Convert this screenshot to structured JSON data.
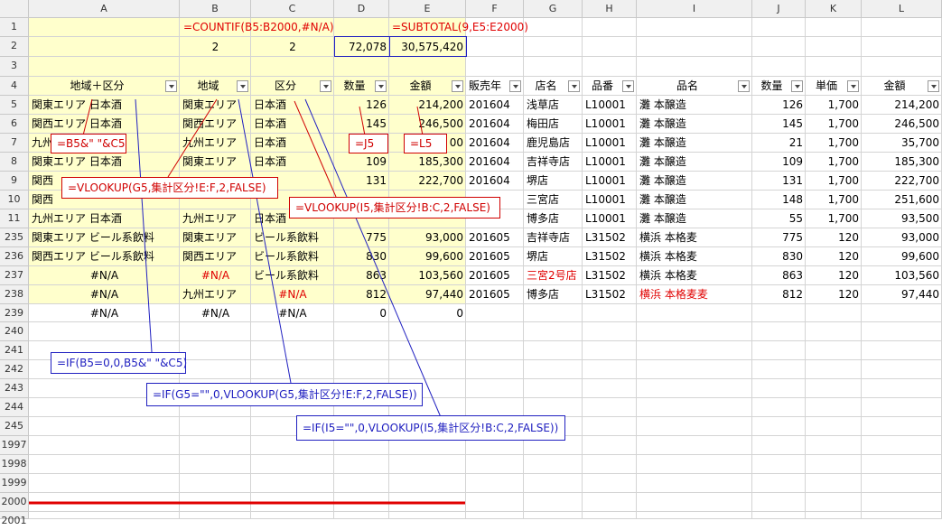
{
  "columns": [
    "A",
    "B",
    "C",
    "D",
    "E",
    "F",
    "G",
    "H",
    "I",
    "J",
    "K",
    "L"
  ],
  "row_headers": [
    "1",
    "2",
    "3",
    "4",
    "5",
    "6",
    "7",
    "8",
    "9",
    "10",
    "11",
    "235",
    "236",
    "237",
    "238",
    "239",
    "240",
    "241",
    "242",
    "243",
    "244",
    "245",
    "1997",
    "1998",
    "1999",
    "2000",
    "2001"
  ],
  "formulas": {
    "countif": "=COUNTIF(B5:B2000,#N/A)",
    "subtotal": "=SUBTOTAL(9,E5:E2000)"
  },
  "row2": {
    "b": "2",
    "c": "2",
    "d": "72,078",
    "e": "30,575,420"
  },
  "headers": {
    "a": "地域＋区分",
    "b": "地域",
    "c": "区分",
    "d": "数量",
    "e": "金額",
    "f": "販売年",
    "g": "店名",
    "h": "品番",
    "i": "品名",
    "j": "数量",
    "k": "単価",
    "l": "金額"
  },
  "rows": [
    {
      "a": "関東エリア 日本酒",
      "b": "関東エリア",
      "c": "日本酒",
      "d": "126",
      "e": "214,200",
      "f": "201604",
      "g": "浅草店",
      "h": "L10001",
      "i": "灘 本醸造",
      "j": "126",
      "k": "1,700",
      "l": "214,200"
    },
    {
      "a": "関西エリア 日本酒",
      "b": "関西エリア",
      "c": "日本酒",
      "d": "145",
      "e": "246,500",
      "f": "201604",
      "g": "梅田店",
      "h": "L10001",
      "i": "灘 本醸造",
      "j": "145",
      "k": "1,700",
      "l": "246,500"
    },
    {
      "a": "九州",
      "b": "九州エリア",
      "c": "日本酒",
      "d": "",
      "e": "00",
      "f": "201604",
      "g": "鹿児島店",
      "h": "L10001",
      "i": "灘 本醸造",
      "j": "21",
      "k": "1,700",
      "l": "35,700"
    },
    {
      "a": "関東エリア 日本酒",
      "b": "関東エリア",
      "c": "日本酒",
      "d": "109",
      "e": "185,300",
      "f": "201604",
      "g": "吉祥寺店",
      "h": "L10001",
      "i": "灘 本醸造",
      "j": "109",
      "k": "1,700",
      "l": "185,300"
    },
    {
      "a": "関西",
      "b": "",
      "c": "",
      "d": "131",
      "e": "222,700",
      "f": "201604",
      "g": "堺店",
      "h": "L10001",
      "i": "灘 本醸造",
      "j": "131",
      "k": "1,700",
      "l": "222,700"
    },
    {
      "a": "関西",
      "b": "",
      "c": "",
      "d": "",
      "e": "",
      "f": "",
      "g": "三宮店",
      "h": "L10001",
      "i": "灘 本醸造",
      "j": "148",
      "k": "1,700",
      "l": "251,600"
    },
    {
      "a": "九州エリア 日本酒",
      "b": "九州エリア",
      "c": "日本酒",
      "d": "",
      "e": "",
      "f": "",
      "g": "博多店",
      "h": "L10001",
      "i": "灘 本醸造",
      "j": "55",
      "k": "1,700",
      "l": "93,500"
    },
    {
      "a": "関東エリア ビール系飲料",
      "b": "関東エリア",
      "c": "ビール系飲料",
      "d": "775",
      "e": "93,000",
      "f": "201605",
      "g": "吉祥寺店",
      "h": "L31502",
      "i": "横浜 本格麦",
      "j": "775",
      "k": "120",
      "l": "93,000"
    },
    {
      "a": "関西エリア ビール系飲料",
      "b": "関西エリア",
      "c": "ビール系飲料",
      "d": "830",
      "e": "99,600",
      "f": "201605",
      "g": "堺店",
      "h": "L31502",
      "i": "横浜 本格麦",
      "j": "830",
      "k": "120",
      "l": "99,600"
    },
    {
      "a": "#N/A",
      "b": "#N/A",
      "c": "ビール系飲料",
      "d": "863",
      "e": "103,560",
      "f": "201605",
      "g": "三宮2号店",
      "h": "L31502",
      "i": "横浜 本格麦",
      "j": "863",
      "k": "120",
      "l": "103,560"
    },
    {
      "a": "#N/A",
      "b": "九州エリア",
      "c": "#N/A",
      "d": "812",
      "e": "97,440",
      "f": "201605",
      "g": "博多店",
      "h": "L31502",
      "i": "横浜 本格麦麦",
      "j": "812",
      "k": "120",
      "l": "97,440"
    },
    {
      "a": "#N/A",
      "b": "#N/A",
      "c": "#N/A",
      "d": "0",
      "e": "0",
      "f": "",
      "g": "",
      "h": "",
      "i": "",
      "j": "",
      "k": "",
      "l": ""
    }
  ],
  "annotations": {
    "a7": "=B5&\" \"&C5",
    "d7": "=J5",
    "e7": "=L5",
    "vlookup_g5": "=VLOOKUP(G5,集計区分!E:F,2,FALSE)",
    "vlookup_i5": "=VLOOKUP(I5,集計区分!B:C,2,FALSE)",
    "if_a": "=IF(B5=0,0,B5&\" \"&C5)",
    "if_b": "=IF(G5=\"\",0,VLOOKUP(G5,集計区分!E:F,2,FALSE))",
    "if_c": "=IF(I5=\"\",0,VLOOKUP(I5,集計区分!B:C,2,FALSE))"
  },
  "colors": {
    "formula_red": "#e00000",
    "annotation_blue": "#2020c0",
    "highlight_yellow": "#ffffcc"
  }
}
